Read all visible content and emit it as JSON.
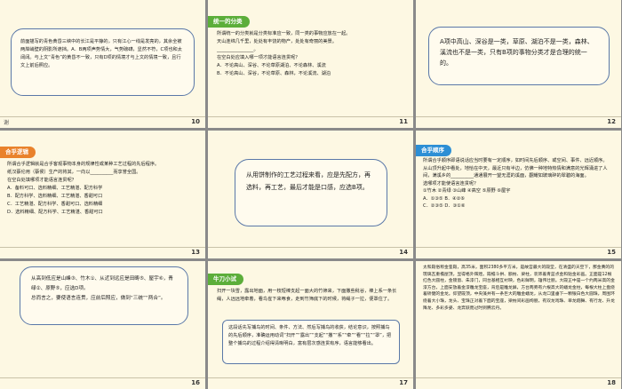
{
  "slides": [
    {
      "num": "10",
      "text": "前面描写的青色黄昏三峡中的长江是平静的，只有江心一线是发亮的，其余全被两岸峭壁的阴影所遮挡。A．B两项声势情大，气势磅礴，显然不符，C项也和太阔阔。与上文“青色”的黄昏不一致，只有D项的情境才与上文的情境一致，且行文上前后照应。"
    },
    {
      "num": "11",
      "tag": "统一的分类",
      "lines": [
        "所谓统一的分类就是分类标准应一致，同一类的事物应放在一起。",
        "天山连绵几千里，处处有丰饶的物产，处处有奇丽的美景。",
        "________________。",
        "在空白处应填入哪一项才能语言连贯呢？",
        "A．不论高山、深谷、不论草原湖泊、不论森林、溪流",
        "B．不论高山、深谷，不论草原、森林，不论溪流、湖泊"
      ]
    },
    {
      "num": "12",
      "text": "A项中高山、深谷是一类，草原、湖泊不是一类，森林、溪流也不是一类，只有B项的事物分类才是合理的统一的。"
    },
    {
      "num": "13",
      "tag": "合乎逻辑",
      "lines": [
        "所谓合乎逻辑就是合乎客观事物本身的规律性或某种工艺过程的先后程序。",
        "纸汉蔡伦用（蔡侯）生产的将其，一向以__________而享誉全国。",
        "在空白处填哪项才能语言连贯呢？",
        "A．备料可口、选料精细、工艺精湛、配方科学",
        "B．配方科学、选料精细、工艺精湛、香甜可口",
        "C．工艺精湛、配方科学、香甜可口、选料精细",
        "D．选料精细、配方科学、工艺精湛、香甜可口"
      ]
    },
    {
      "num": "14",
      "text": "从用饼制作的工艺过程来看，应是先配方，再选料，再工艺，最后才能是口感，应选B项。"
    },
    {
      "num": "15",
      "tag": "合乎顺序",
      "lines": [
        "所谓合乎顺序即语说话应当时要有一定顺序，如时间先后顺序、或空间、事件、远近顺序。",
        "从山顶升起中看处，地恰在中天，最近只有半边，仿佛一种地特热情和满意的光辉涌进了人间，满溪乡的__________通通展开一望无涯的溪面，翻耀如玻璃碎的翠碧的海面。",
        "选哪项才能使语言连贯呢？",
        "①竹木  ②青绿  ③山峰  ④高空  ⑤原野  ⑥屋宇",
        "A．①③⑤  B．④②⑥",
        "C．②③⑤  D．③①⑥"
      ]
    },
    {
      "num": "16",
      "text": "从高到低应是山峰③、竹木①、从近到远应是田畴⑤、屋宇⑥，青绿②、原野⑤，应选D项。",
      "text2": "总而言之，要使语言连贯，应前后照应，做到“三统”“两合”。"
    },
    {
      "num": "17",
      "tag": "牛刀小试",
      "lines": [
        "扫开一块雪，露出地面，用一枝短棒支起一面大的竹筛来，下面撒些秕谷，棒上系一条长绳，人远远地牵着，看鸟雀下来啄食，走到竹筛底下的时候，将绳子一拉，便罩住了。",
        "这段话先写捕鸟的时间、条件、方法、然后写捕鸟的收获，结论意识，按照捕鸟的先后顺序，准确运用动词“扫开”“露出”“支起”“撒”“系”“牵”“看”“拉”“罩”，把整个捕鸟的过程介绍得清晰明白，富有层次感连贯有序，语言能够看出。"
      ]
    },
    {
      "num": "18",
      "text": "太和殿俗称金銮殿，高35米，面积2380多平方米，是故宫最大的殿堂，在清盛的天空下，那金黄的的琉璃瓦重檐屋顶，显得格外辉煌。殿檐斗拱、额枋、梁柱，装饰着青蓝点金和贴金彩画。正面是12根红色大圆柱，金锁窗、朱漆门，同台基相互衬映，色彩鲜明，雄伟壮丽。大殿正中是一个约两米高的金漆方台，上面安放着金漆雕龙宝座，背后是雕龙屏，方台两旁有六根高大的蟠龙金柱，每根大柱上盘绕着矫健的金龙。仰望殿顶，中央藻井有一条巨大的雕金蟠龙，从龙口里垂下一颗银白色大圆珠，周围环绕着大小珠，龙头、宝珠正对着下面的宝座，梁枋间彩画绚丽，有双龙戏珠、单龙翔舞、有行龙、升龙降龙、多彩多姿、龙奔跃而过时到腾云丹。"
    }
  ],
  "footer_text": "谢",
  "colors": {
    "tag_orange": "#e9822c",
    "tag_green": "#5cae3a",
    "tag_blue": "#2d8fd5",
    "border_blue": "#5a78a8",
    "slide_bg": "#fdf8e3"
  }
}
